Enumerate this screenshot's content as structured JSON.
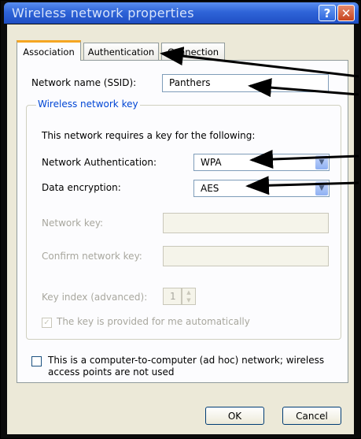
{
  "window": {
    "title": "Wireless network properties",
    "help_glyph": "?",
    "close_glyph": "✕"
  },
  "tabs": [
    {
      "label": "Association",
      "active": true
    },
    {
      "label": "Authentication",
      "active": false
    },
    {
      "label": "Connection",
      "active": false
    }
  ],
  "association": {
    "ssid_label": "Network name (SSID):",
    "ssid_value": "Panthers",
    "key_group_label": "Wireless network key",
    "key_intro": "This network requires a key for the following:",
    "auth_label": "Network Authentication:",
    "auth_value": "WPA",
    "encryption_label": "Data encryption:",
    "encryption_value": "AES",
    "network_key_label": "Network key:",
    "network_key_value": "",
    "confirm_key_label": "Confirm network key:",
    "confirm_key_value": "",
    "key_index_label": "Key index (advanced):",
    "key_index_value": "1",
    "auto_key_label": "The key is provided for me automatically",
    "auto_key_checked": true,
    "adhoc_label_line1": "This is a computer-to-computer (ad hoc) network; wireless",
    "adhoc_label_line2": "access points are not used",
    "adhoc_checked": false
  },
  "buttons": {
    "ok": "OK",
    "cancel": "Cancel"
  },
  "icons": {
    "combo_arrow": "chevron-down-icon",
    "spin_up": "spin-up-icon",
    "spin_down": "spin-down-icon",
    "check": "checkmark-icon"
  },
  "colors": {
    "titlebar": "#2f64d8",
    "tab_highlight": "#f5a623",
    "group_label": "#0046d5",
    "window_frame": "#0b0b0b",
    "client_bg": "#ece9d8"
  }
}
